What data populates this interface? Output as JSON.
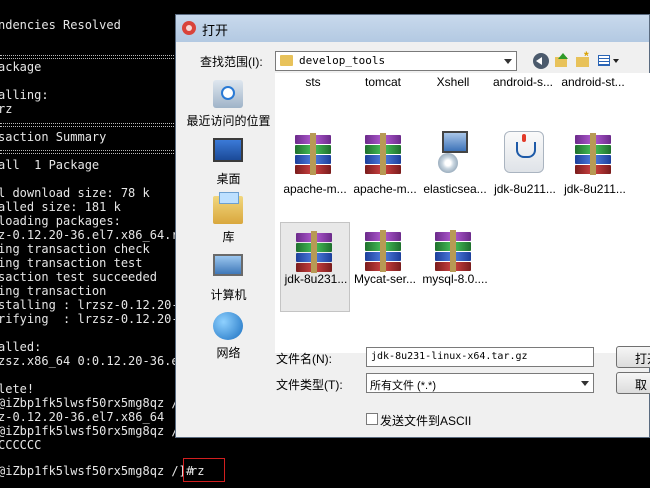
{
  "terminal": {
    "lines": [
      "ndencies Resolved",
      "ackage",
      "alling:",
      "rz",
      "saction Summary",
      "all  1 Package",
      "l download size: 78 k",
      "alled size: 181 k",
      "loading packages:",
      "z-0.12.20-36.el7.x86_64.rpm",
      "ing transaction check",
      "ing transaction test",
      "saction test succeeded",
      "ing transaction",
      "stalling : lrzsz-0.12.20-36.",
      "rifying  : lrzsz-0.12.20-36.",
      "alled:",
      "zsz.x86_64 0:0.12.20-36.el7",
      "lete!",
      "@iZbp1fk5lwsf50rx5mg8qz /]",
      "z-0.12.20-36.el7.x86_64",
      "@iZbp1fk5lwsf50rx5mg8qz /]",
      "CCCCCC",
      "@iZbp1fk5lwsf50rx5mg8qz /]#"
    ],
    "command": "rz"
  },
  "dialog": {
    "title": "打开",
    "look_in_label": "查找范围(I):",
    "look_in_value": "develop_tools",
    "places": [
      {
        "label": "最近访问的位置"
      },
      {
        "label": "桌面"
      },
      {
        "label": "库"
      },
      {
        "label": "计算机"
      },
      {
        "label": "网络"
      }
    ],
    "top_row": [
      "sts",
      "tomcat",
      "Xshell",
      "android-s...",
      "android-st..."
    ],
    "files": [
      {
        "label": "apache-m...",
        "icon": "archive-icon"
      },
      {
        "label": "apache-m...",
        "icon": "archive-icon"
      },
      {
        "label": "elasticsea...",
        "icon": "setup-icon"
      },
      {
        "label": "jdk-8u211...",
        "icon": "java-icon"
      },
      {
        "label": "jdk-8u211...",
        "icon": "archive-icon"
      },
      {
        "label": "jdk-8u231...",
        "icon": "archive-icon"
      },
      {
        "label": "Mycat-ser...",
        "icon": "archive-icon"
      },
      {
        "label": "mysql-8.0....",
        "icon": "archive-icon"
      }
    ],
    "file_name_label": "文件名(N):",
    "file_name_value": "jdk-8u231-linux-x64.tar.gz",
    "file_type_label": "文件类型(T):",
    "file_type_value": "所有文件 (*.*)",
    "open_button": "打开",
    "cancel_button": "取",
    "ascii_checkbox_label": "发送文件到ASCII"
  }
}
